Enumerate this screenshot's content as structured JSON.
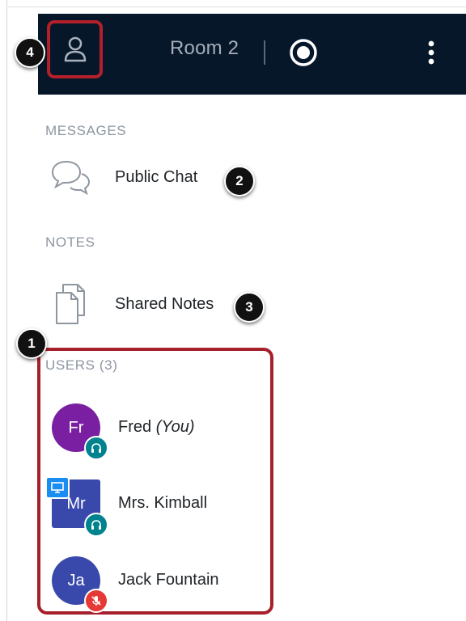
{
  "header": {
    "room_title": "Room 2",
    "icons": {
      "user": "user-icon",
      "record": "record-icon",
      "menu": "kebab-menu-icon"
    }
  },
  "callouts": {
    "one": "1",
    "two": "2",
    "three": "3",
    "four": "4"
  },
  "messages": {
    "section_label": "MESSAGES",
    "public_chat": "Public Chat"
  },
  "notes": {
    "section_label": "NOTES",
    "shared_notes": "Shared Notes"
  },
  "users": {
    "section_label": "USERS (3)",
    "list": [
      {
        "initials": "Fr",
        "name": "Fred",
        "suffix": "(You)",
        "avatar_color": "#7b1fa2",
        "status": "headset",
        "status_color": "#00838f"
      },
      {
        "initials": "Mr",
        "name": "Mrs. Kimball",
        "suffix": "",
        "avatar_color": "#3949ab",
        "status": "headset",
        "status_color": "#00838f",
        "presenter": true
      },
      {
        "initials": "Ja",
        "name": "Jack Fountain",
        "suffix": "",
        "avatar_color": "#3949ab",
        "status": "muted-mic",
        "status_color": "#e53935"
      }
    ]
  },
  "colors": {
    "topbar": "#06172a",
    "highlight": "#b3202a",
    "section_text": "#8d96a0"
  }
}
